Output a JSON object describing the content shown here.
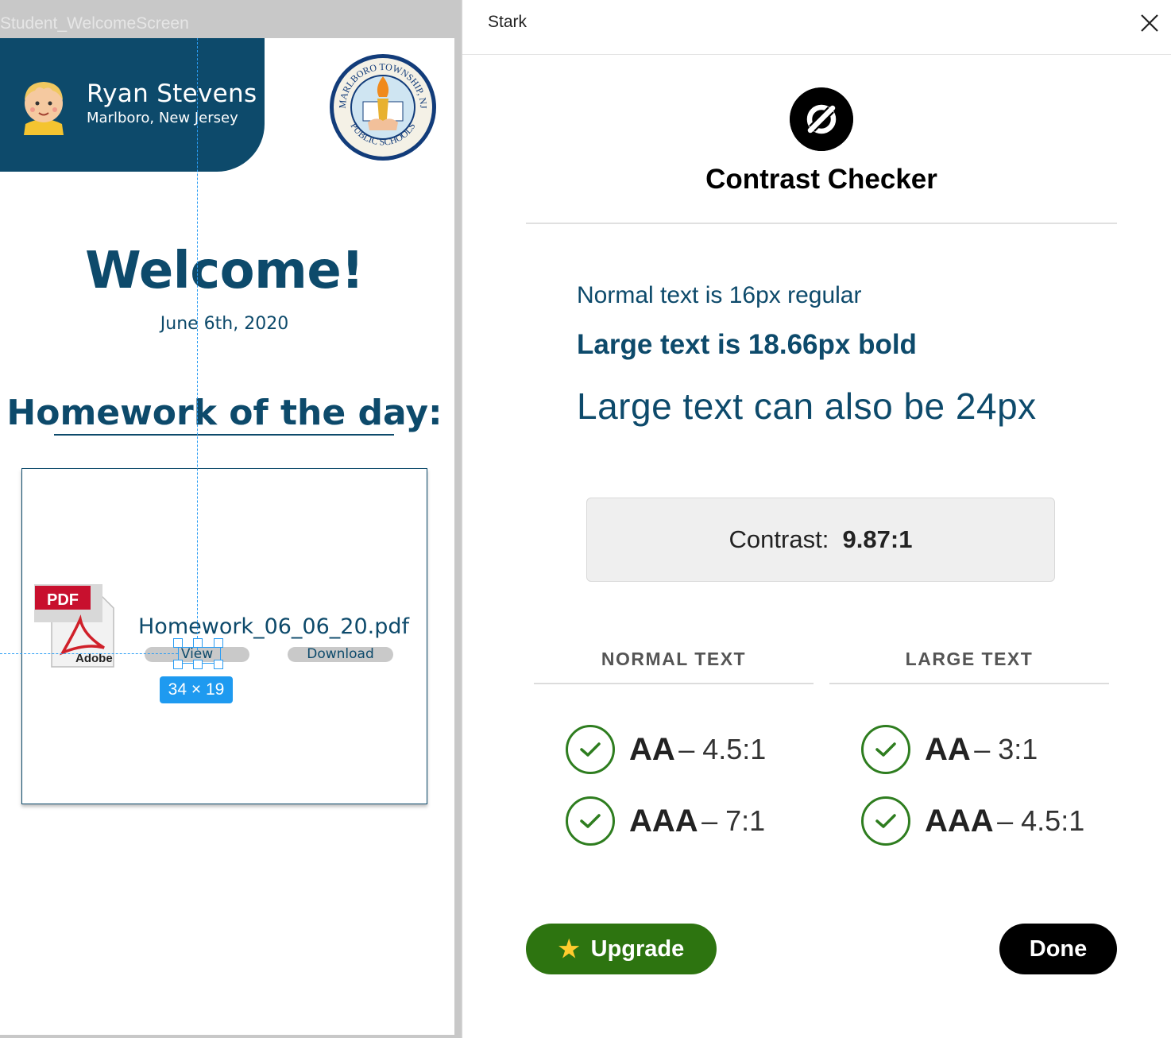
{
  "canvas": {
    "frame_label": "Student_WelcomeScreen",
    "profile": {
      "name": "Ryan Stevens",
      "location": "Marlboro, New Jersey"
    },
    "logo": {
      "ring_top": "MARLBORO TOWNSHIP, NJ",
      "ring_bottom": "PUBLIC SCHOOLS"
    },
    "welcome_title": "Welcome!",
    "date": "June 6th, 2020",
    "homework_heading": "Homework of the day:",
    "file": {
      "pdf_badge": "PDF",
      "pdf_brand": "Adobe",
      "name": "Homework_06_06_20.pdf",
      "view_label": "View",
      "download_label": "Download"
    },
    "selection_size": "34 × 19"
  },
  "panel": {
    "title": "Stark",
    "checker_title": "Contrast Checker",
    "samples": {
      "normal": "Normal text is 16px regular",
      "bold": "Large text is 18.66px bold",
      "large": "Large text can also be 24px"
    },
    "contrast": {
      "label": "Contrast:",
      "value": "9.87:1"
    },
    "columns": [
      {
        "header": "NORMAL TEXT",
        "results": [
          {
            "level": "AA",
            "ratio": "– 4.5:1"
          },
          {
            "level": "AAA",
            "ratio": "– 7:1"
          }
        ]
      },
      {
        "header": "LARGE TEXT",
        "results": [
          {
            "level": "AA",
            "ratio": "– 3:1"
          },
          {
            "level": "AAA",
            "ratio": "– 4.5:1"
          }
        ]
      }
    ],
    "upgrade_label": "Upgrade",
    "done_label": "Done"
  },
  "colors": {
    "brand_navy": "#0d4a6b",
    "pass_green": "#2e7d1f",
    "upgrade_green": "#2d7410",
    "guide_blue": "#1e9af0"
  }
}
